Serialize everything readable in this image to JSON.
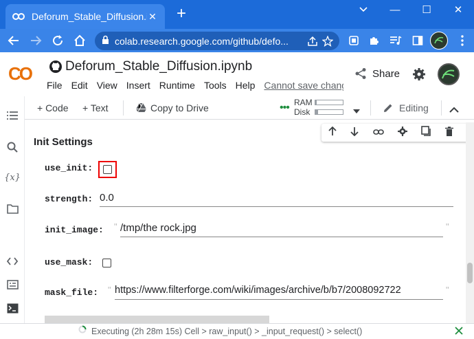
{
  "browser": {
    "tab_title": "Deforum_Stable_Diffusion.ipynb",
    "tab_close": "✕",
    "new_tab": "+",
    "url": "colab.research.google.com/github/defo...",
    "window": {
      "minimize": "—",
      "maximize": "☐",
      "close": "✕"
    }
  },
  "colab": {
    "logo": "CO",
    "notebook_title": "Deforum_Stable_Diffusion.ipynb",
    "menu": [
      "File",
      "Edit",
      "View",
      "Insert",
      "Runtime",
      "Tools",
      "Help"
    ],
    "save_notice": "Cannot save changes",
    "share_label": "Share",
    "toolbar": {
      "add_code": "+ Code",
      "add_text": "+ Text",
      "copy_to_drive": "Copy to Drive",
      "ram_label": "RAM",
      "disk_label": "Disk",
      "ram_usage": 0.05,
      "disk_usage": 0.1,
      "editing_label": "Editing"
    }
  },
  "cell": {
    "section_title": "Init Settings",
    "params": {
      "use_init": {
        "label": "use_init:",
        "checked": false
      },
      "strength": {
        "label": "strength:",
        "value": "0.0"
      },
      "init_image": {
        "label": "init_image:",
        "value": "/tmp/the rock.jpg"
      },
      "use_mask": {
        "label": "use_mask:",
        "checked": false
      },
      "mask_file": {
        "label": "mask_file:",
        "value": "https://www.filterforge.com/wiki/images/archive/b/b7/2008092722"
      }
    },
    "quote_char": "\""
  },
  "status": {
    "text": "Executing (2h 28m 15s)  Cell > raw_input() > _input_request() > select()"
  },
  "colors": {
    "chrome_blue": "#1c6bd9",
    "highlight_red": "#ee0000",
    "status_green": "#1e8e3e"
  }
}
